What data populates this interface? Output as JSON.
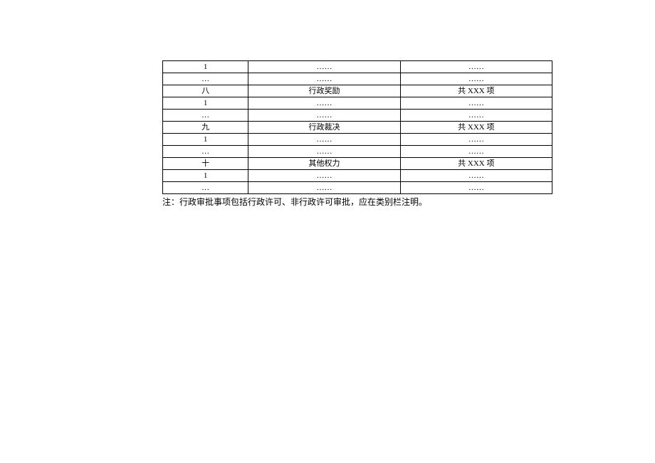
{
  "rows": [
    {
      "c1": "1",
      "c2": "……",
      "c3": "……"
    },
    {
      "c1": "…",
      "c2": "……",
      "c3": "……"
    },
    {
      "c1": "八",
      "c2": "行政奖励",
      "c3": "共 XXX 项"
    },
    {
      "c1": "1",
      "c2": "……",
      "c3": "……"
    },
    {
      "c1": "…",
      "c2": "……",
      "c3": "……"
    },
    {
      "c1": "九",
      "c2": "行政裁决",
      "c3": "共 XXX 项"
    },
    {
      "c1": "1",
      "c2": "……",
      "c3": "……"
    },
    {
      "c1": "…",
      "c2": "……",
      "c3": "……"
    },
    {
      "c1": "十",
      "c2": "其他权力",
      "c3": "共 XXX 项"
    },
    {
      "c1": "1",
      "c2": "……",
      "c3": "……"
    },
    {
      "c1": "…",
      "c2": "……",
      "c3": "……"
    }
  ],
  "note": "注：行政审批事项包括行政许可、非行政许可审批，应在类别栏注明。"
}
